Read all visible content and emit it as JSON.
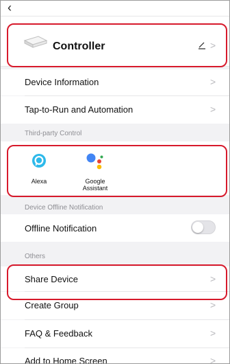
{
  "nav": {
    "back_icon": "chevron-left-icon"
  },
  "device": {
    "name": "Controller",
    "edit_icon": "pencil-icon"
  },
  "rows": {
    "device_information": "Device Information",
    "tap_to_run": "Tap-to-Run and Automation",
    "offline_notification": "Offline Notification",
    "share_device": "Share Device",
    "create_group": "Create Group",
    "faq": "FAQ & Feedback",
    "add_home": "Add to Home Screen"
  },
  "sections": {
    "third_party": "Third-party Control",
    "offline": "Device Offline Notification",
    "others": "Others"
  },
  "third_party": [
    {
      "name": "Alexa",
      "icon": "alexa-icon"
    },
    {
      "name": "Google\nAssistant",
      "icon": "google-assistant-icon"
    }
  ],
  "toggle": {
    "offline_notification_on": false
  },
  "colors": {
    "highlight": "#d7192b",
    "alexa": "#2db9ea"
  }
}
